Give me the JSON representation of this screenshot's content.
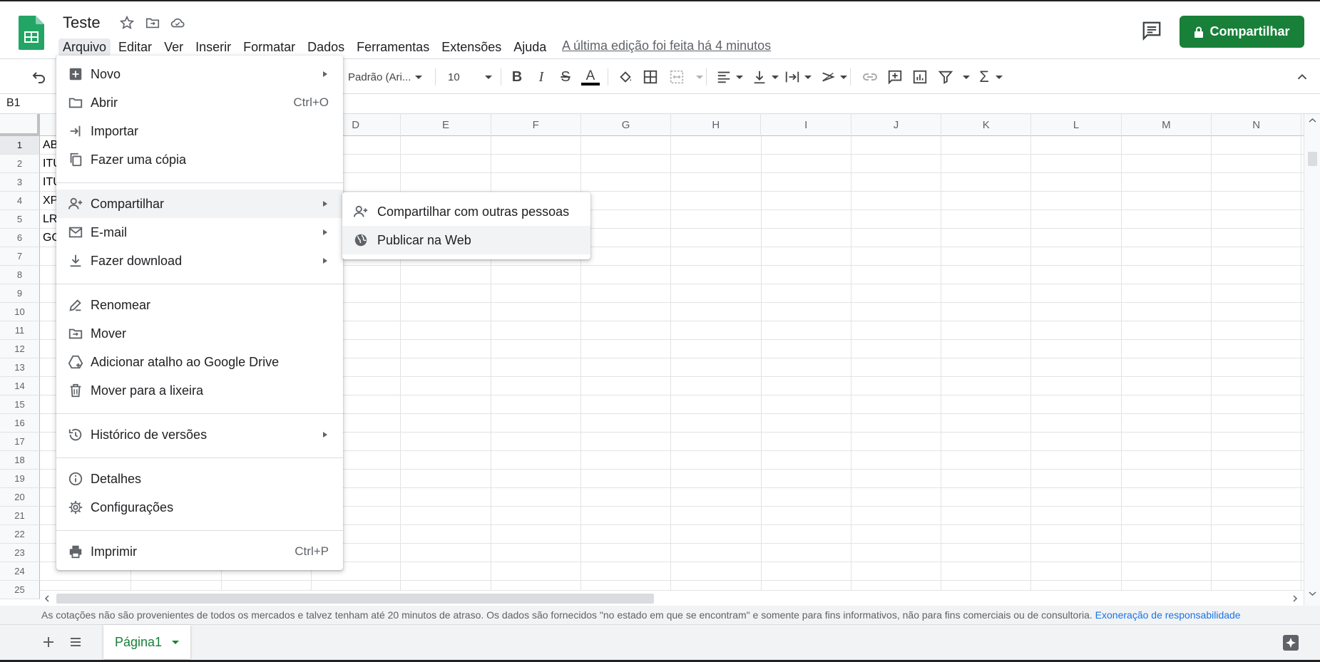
{
  "header": {
    "doc_title": "Teste",
    "share_label": "Compartilhar",
    "last_edit": "A última edição foi feita há 4 minutos"
  },
  "menubar": [
    "Arquivo",
    "Editar",
    "Ver",
    "Inserir",
    "Formatar",
    "Dados",
    "Ferramentas",
    "Extensões",
    "Ajuda"
  ],
  "toolbar": {
    "font": "Padrão (Ari...",
    "font_size": "10"
  },
  "formula_bar": {
    "cell_ref": "B1"
  },
  "grid": {
    "columns": [
      "D",
      "E",
      "F",
      "G",
      "H",
      "I",
      "J",
      "K",
      "L",
      "M",
      "N"
    ],
    "rows": [
      "1",
      "2",
      "3",
      "4",
      "5",
      "6",
      "7",
      "8",
      "9",
      "10",
      "11",
      "12",
      "13",
      "14",
      "15",
      "16",
      "17",
      "18",
      "19",
      "20",
      "21",
      "22",
      "23",
      "24",
      "25"
    ],
    "cell_fragments": [
      "AB",
      "ITU",
      "ITU",
      "XP",
      "LR",
      "GO"
    ]
  },
  "file_menu": {
    "items": [
      {
        "label": "Novo",
        "icon": "add-sheet-icon",
        "submenu": true
      },
      {
        "label": "Abrir",
        "icon": "folder-icon",
        "shortcut": "Ctrl+O"
      },
      {
        "label": "Importar",
        "icon": "import-icon"
      },
      {
        "label": "Fazer uma cópia",
        "icon": "copy-icon"
      },
      {
        "label": "Compartilhar",
        "icon": "person-add-icon",
        "submenu": true,
        "highlighted": true
      },
      {
        "label": "E-mail",
        "icon": "mail-icon",
        "submenu": true
      },
      {
        "label": "Fazer download",
        "icon": "download-icon",
        "submenu": true
      },
      {
        "label": "Renomear",
        "icon": "rename-icon"
      },
      {
        "label": "Mover",
        "icon": "move-folder-icon"
      },
      {
        "label": "Adicionar atalho ao Google Drive",
        "icon": "drive-shortcut-icon"
      },
      {
        "label": "Mover para a lixeira",
        "icon": "trash-icon"
      },
      {
        "label": "Histórico de versões",
        "icon": "history-icon",
        "submenu": true
      },
      {
        "label": "Detalhes",
        "icon": "info-icon"
      },
      {
        "label": "Configurações",
        "icon": "gear-icon"
      },
      {
        "label": "Imprimir",
        "icon": "printer-icon",
        "shortcut": "Ctrl+P"
      }
    ]
  },
  "share_submenu": {
    "items": [
      {
        "label": "Compartilhar com outras pessoas",
        "icon": "person-add-icon"
      },
      {
        "label": "Publicar na Web",
        "icon": "globe-icon",
        "highlighted": true
      }
    ]
  },
  "disclaimer": {
    "text": "As cotações não são provenientes de todos os mercados e talvez tenham até 20 minutos de atraso. Os dados são fornecidos \"no estado em que se encontram\" e somente para fins informativos, não para fins comerciais ou de consultoria.",
    "link": "Exoneração de responsabilidade"
  },
  "sheet_tabs": {
    "active": "Página1"
  },
  "colors": {
    "accent_green": "#188038",
    "link_blue": "#1a73e8",
    "hover": "#f1f3f4"
  }
}
